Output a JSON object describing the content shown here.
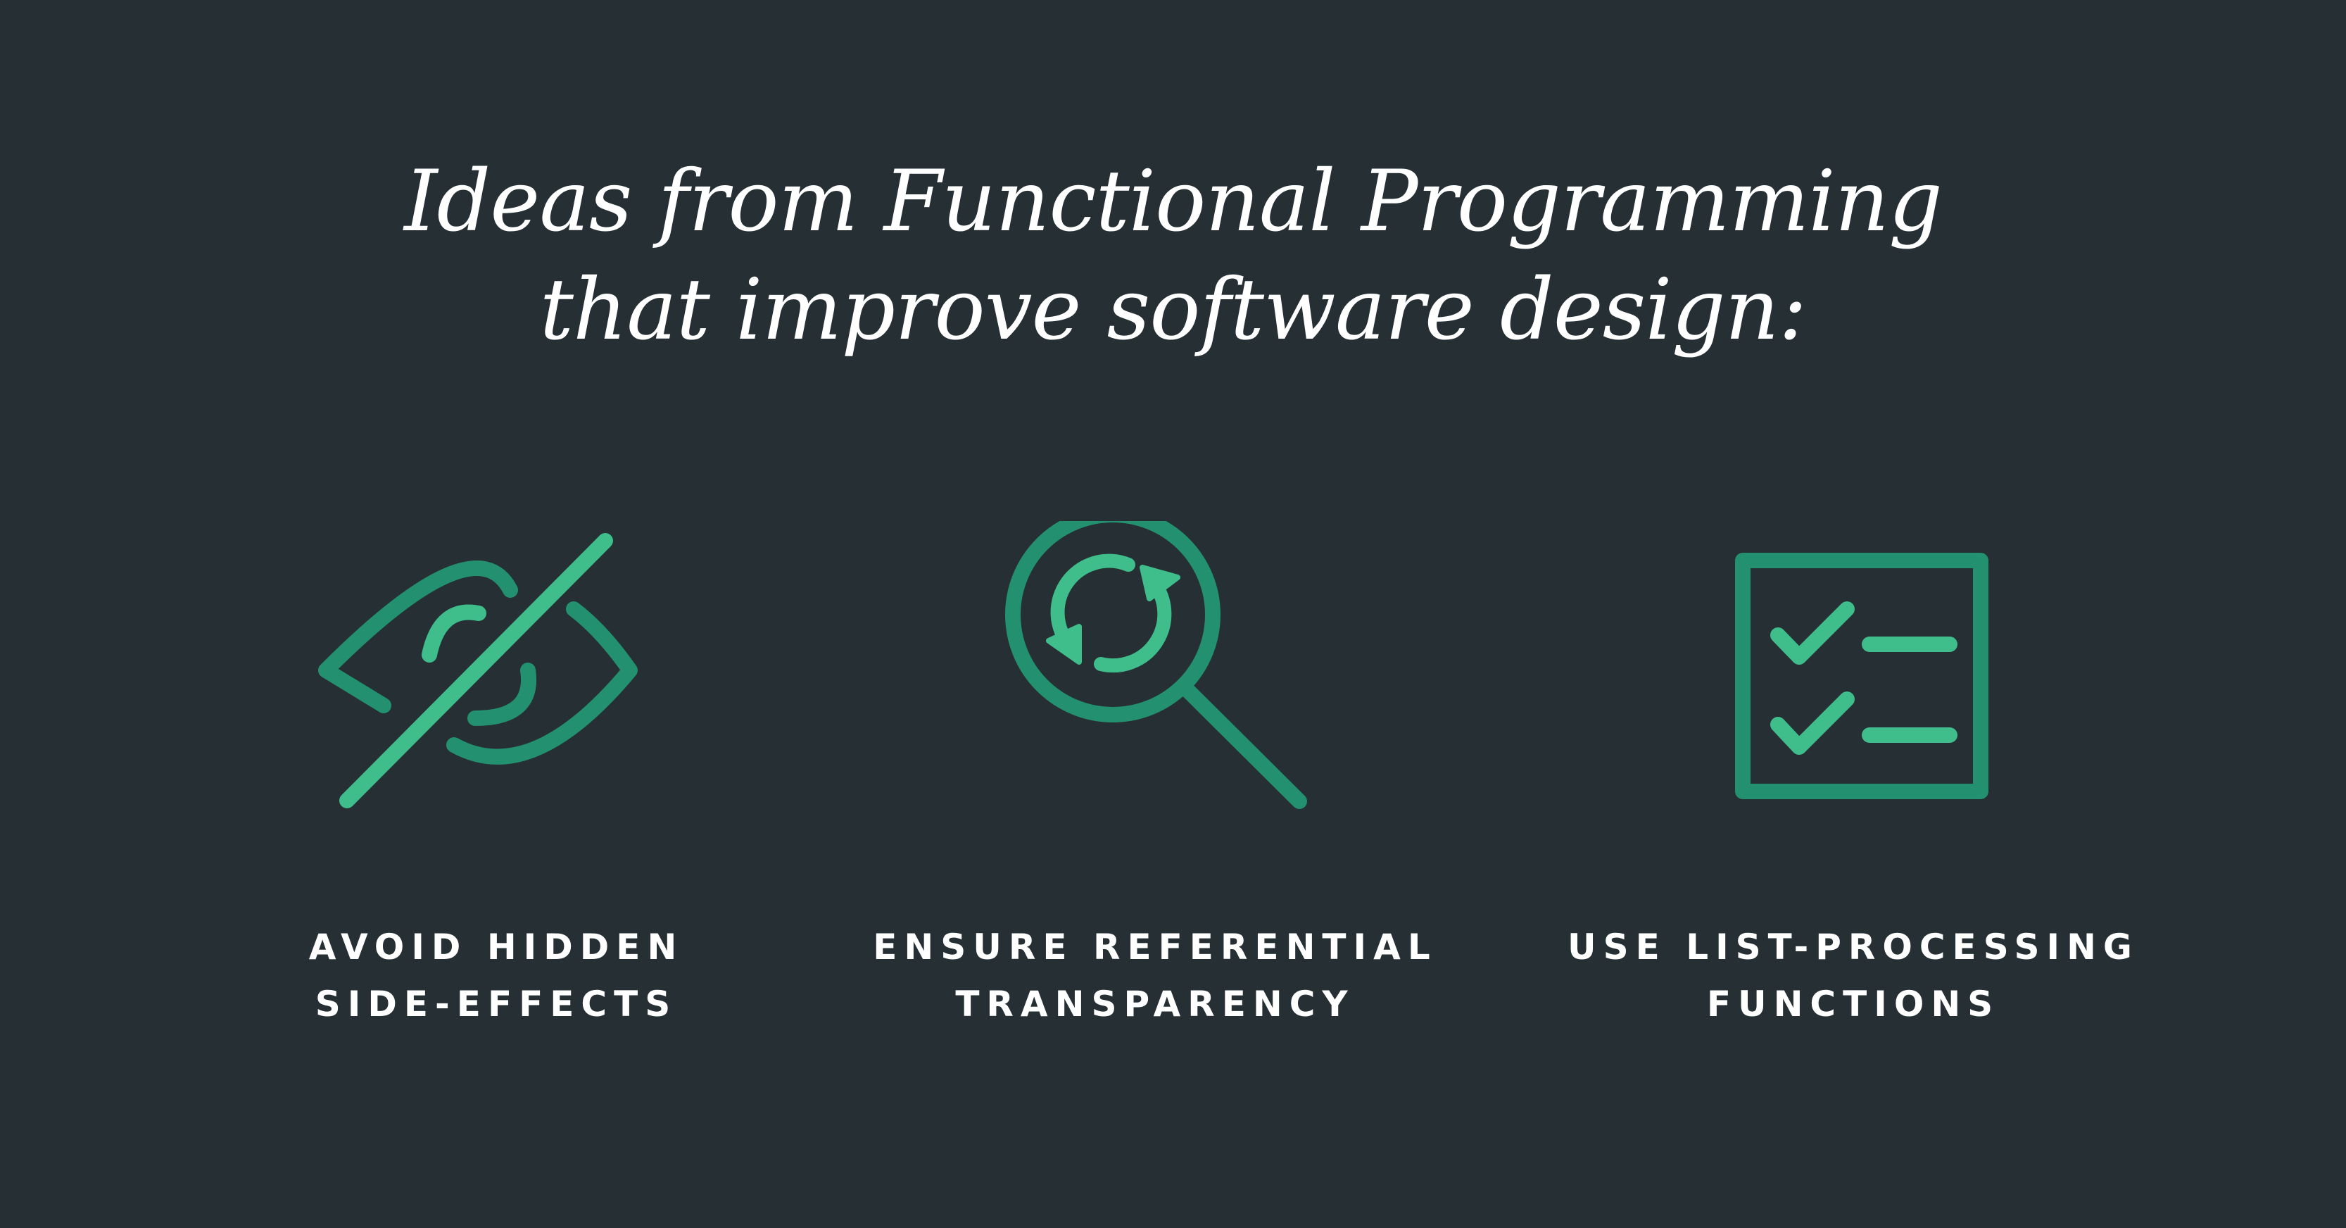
{
  "title": {
    "line1": "Ideas from Functional Programming",
    "line2": "that improve software design:"
  },
  "colors": {
    "background": "#252f34",
    "accent_dark": "#23916f",
    "accent_light": "#3fbe8b",
    "text": "#ffffff"
  },
  "features": [
    {
      "icon": "eye-slash-icon",
      "label_line1": "AVOID HIDDEN",
      "label_line2": "SIDE-EFFECTS"
    },
    {
      "icon": "magnifier-refresh-icon",
      "label_line1": "ENSURE REFERENTIAL",
      "label_line2": "TRANSPARENCY"
    },
    {
      "icon": "checklist-icon",
      "label_line1": "USE LIST-PROCESSING",
      "label_line2": "FUNCTIONS"
    }
  ]
}
